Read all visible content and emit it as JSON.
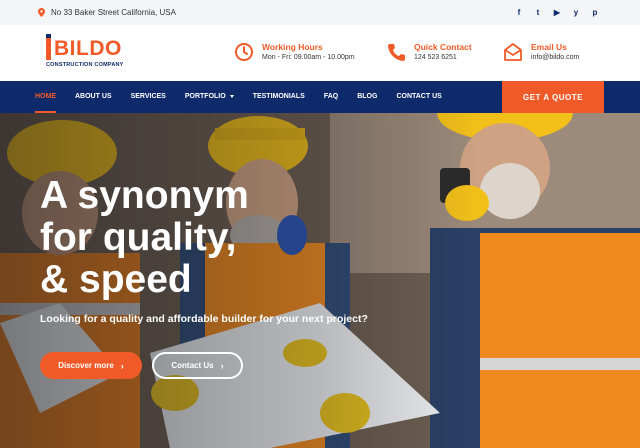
{
  "topbar": {
    "address": "No 33 Baker Street California, USA",
    "socials": [
      {
        "icon": "facebook-icon",
        "glyph": "f"
      },
      {
        "icon": "twitter-icon",
        "glyph": "t"
      },
      {
        "icon": "youtube-icon",
        "glyph": "▶"
      },
      {
        "icon": "yelp-icon",
        "glyph": "y"
      },
      {
        "icon": "pinterest-icon",
        "glyph": "p"
      }
    ]
  },
  "logo": {
    "name": "BILDO",
    "subtitle": "CONSTRUCTION COMPANY"
  },
  "contact": {
    "hours": {
      "title": "Working Hours",
      "value": "Mon - Fri: 09.00am - 10.00pm"
    },
    "quick": {
      "title": "Quick Contact",
      "value": "124 523 6251"
    },
    "email": {
      "title": "Email Us",
      "value": "info@bildo.com"
    }
  },
  "nav": {
    "items": [
      "HOME",
      "ABOUT US",
      "SERVICES",
      "PORTFOLIO",
      "TESTIMONIALS",
      "FAQ",
      "BLOG",
      "CONTACT US"
    ],
    "active": "HOME",
    "cta": "GET A QUOTE"
  },
  "hero": {
    "headline_1": "A synonym",
    "headline_2": "for quality,",
    "headline_3": "& speed",
    "tagline": "Looking for a quality and affordable builder for your next project?",
    "primary_button": "Discover more",
    "secondary_button": "Contact Us"
  },
  "colors": {
    "accent": "#f05a28",
    "navy": "#0f2a6b"
  }
}
